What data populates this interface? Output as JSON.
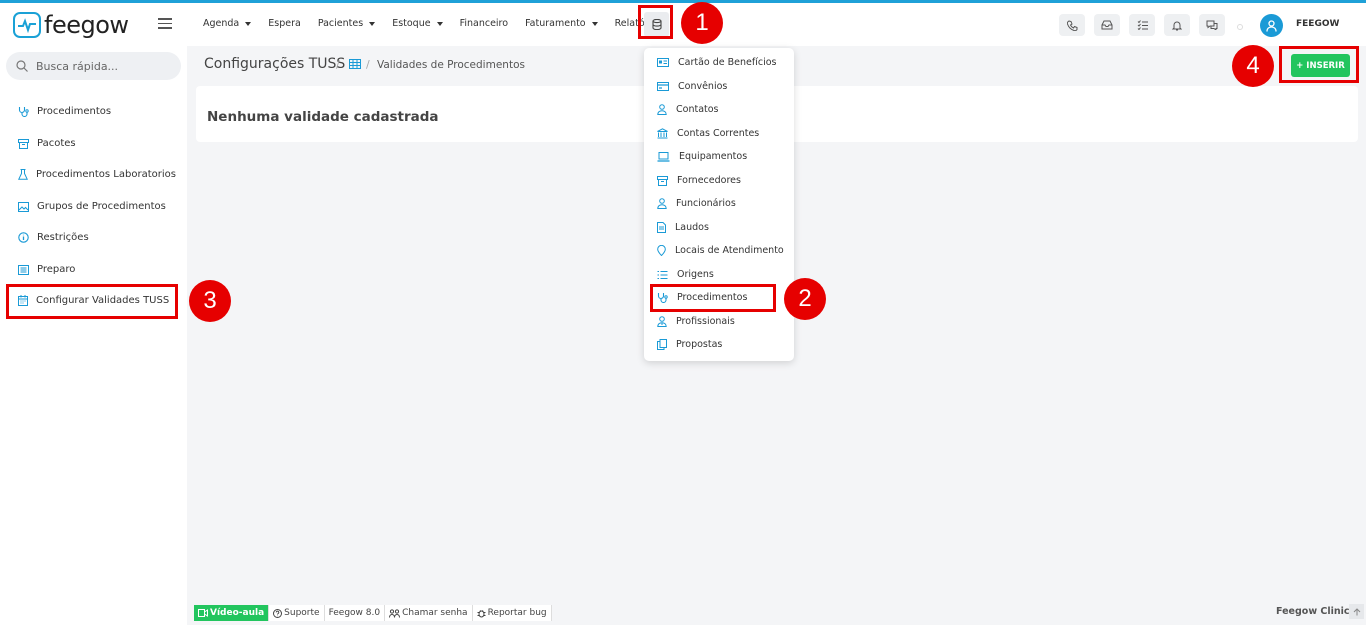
{
  "app": {
    "logo_text": "feegow",
    "brand_color": "#1aa1d6"
  },
  "nav": {
    "items": [
      {
        "label": "Agenda",
        "caret": true
      },
      {
        "label": "Espera",
        "caret": false
      },
      {
        "label": "Pacientes",
        "caret": true
      },
      {
        "label": "Estoque",
        "caret": true
      },
      {
        "label": "Financeiro",
        "caret": false
      },
      {
        "label": "Faturamento",
        "caret": true
      },
      {
        "label": "Relatórios",
        "caret": false
      }
    ]
  },
  "header": {
    "user_name": "FEEGOW",
    "icons": [
      "phone-icon",
      "inbox-icon",
      "tasks-icon",
      "bell-icon",
      "chat-icon"
    ]
  },
  "sidebar": {
    "search_placeholder": "Busca rápida...",
    "items": [
      {
        "label": "Procedimentos",
        "icon": "stethoscope-icon"
      },
      {
        "label": "Pacotes",
        "icon": "box-icon"
      },
      {
        "label": "Procedimentos Laboratorios",
        "icon": "flask-icon"
      },
      {
        "label": "Grupos de Procedimentos",
        "icon": "image-icon"
      },
      {
        "label": "Restrições",
        "icon": "info-icon"
      },
      {
        "label": "Preparo",
        "icon": "list-icon"
      },
      {
        "label": "Configurar Validades TUSS",
        "icon": "calendar-icon"
      }
    ]
  },
  "main": {
    "title": "Configurações TUSS",
    "breadcrumb_current": "Validades de Procedimentos",
    "insert_label": "+ INSERIR",
    "empty_message": "Nenhuma validade cadastrada"
  },
  "dropdown": {
    "items": [
      {
        "label": "Cartão de Benefícios",
        "icon": "id-card-icon"
      },
      {
        "label": "Convênios",
        "icon": "credit-card-icon"
      },
      {
        "label": "Contatos",
        "icon": "user-icon"
      },
      {
        "label": "Contas Correntes",
        "icon": "bank-icon"
      },
      {
        "label": "Equipamentos",
        "icon": "laptop-icon"
      },
      {
        "label": "Fornecedores",
        "icon": "box-icon"
      },
      {
        "label": "Funcionários",
        "icon": "user-icon"
      },
      {
        "label": "Laudos",
        "icon": "document-icon"
      },
      {
        "label": "Locais de Atendimento",
        "icon": "location-icon"
      },
      {
        "label": "Origens",
        "icon": "list-icon"
      },
      {
        "label": "Procedimentos",
        "icon": "stethoscope-icon"
      },
      {
        "label": "Profissionais",
        "icon": "user-doctor-icon"
      },
      {
        "label": "Propostas",
        "icon": "copy-icon"
      }
    ]
  },
  "footer": {
    "video_label": "Vídeo-aula",
    "suporte_label": "Suporte",
    "version_label": "Feegow 8.0",
    "chamar_label": "Chamar senha",
    "bug_label": "Reportar bug",
    "clinic_label": "Feegow Clinic"
  },
  "annotations": {
    "color": "#e60000",
    "badges": [
      "1",
      "2",
      "3",
      "4"
    ]
  }
}
